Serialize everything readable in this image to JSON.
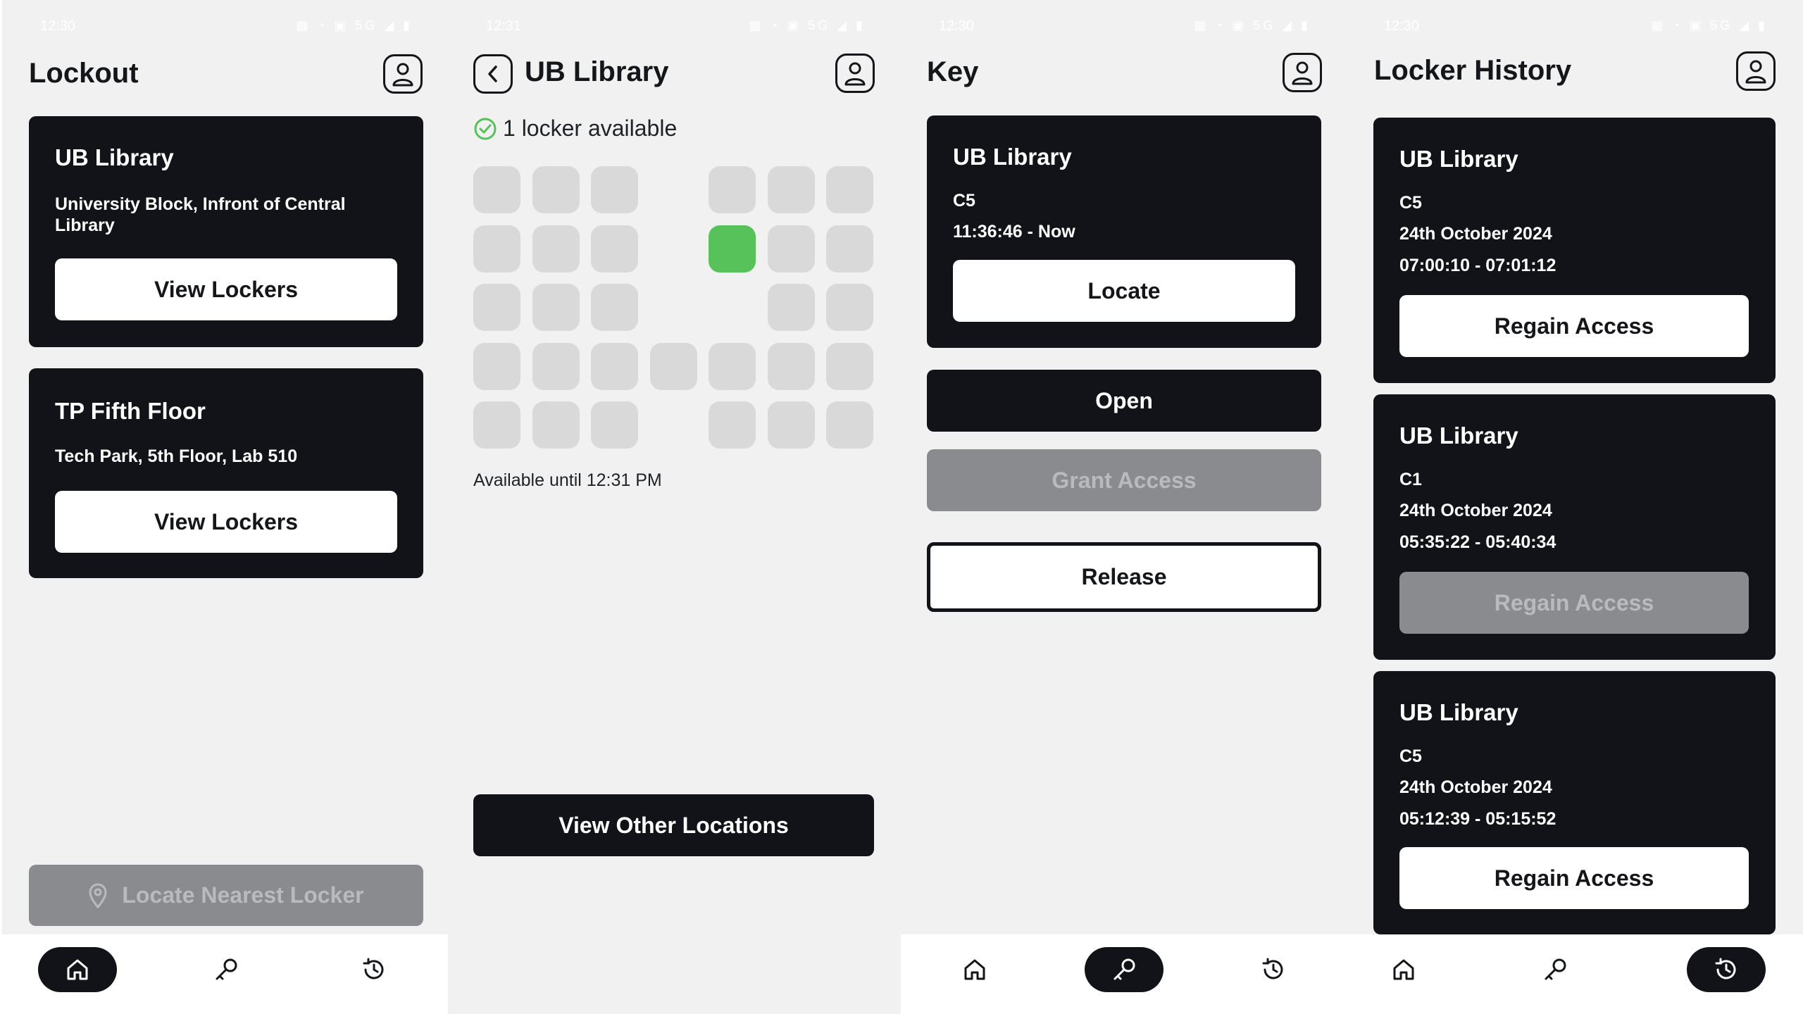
{
  "screens": {
    "home": {
      "status": {
        "time": "12:30",
        "icons": "▦ ◔ ▣ 5G ◢ ▮"
      },
      "title": "Lockout",
      "locations": [
        {
          "name": "UB Library",
          "address": "University Block, Infront of Central Library",
          "button": "View Lockers"
        },
        {
          "name": "TP Fifth Floor",
          "address": "Tech Park, 5th Floor, Lab 510",
          "button": "View Lockers"
        }
      ],
      "locate_nearest": "Locate Nearest Locker"
    },
    "library": {
      "status": {
        "time": "12:31",
        "icons": "▦ ◔ ▣ 5G ◢ ▮"
      },
      "title": "UB Library",
      "available_text": "1 locker available",
      "available_until": "Available until 12:31 PM",
      "locker_rows": [
        [
          1,
          1,
          1,
          0,
          1,
          1,
          1
        ],
        [
          1,
          1,
          1,
          0,
          2,
          1,
          1
        ],
        [
          1,
          1,
          1,
          0,
          0,
          1,
          1
        ],
        [
          1,
          1,
          1,
          1,
          1,
          1,
          1
        ],
        [
          1,
          1,
          1,
          0,
          1,
          1,
          1
        ]
      ],
      "view_other": "View Other Locations"
    },
    "key": {
      "status": {
        "time": "12:30",
        "icons": "▦ ◔ ▣ 5G ◢ ▮"
      },
      "title": "Key",
      "card": {
        "location": "UB Library",
        "locker": "C5",
        "time": "11:36:46 - Now",
        "button": "Locate"
      },
      "open": "Open",
      "grant": "Grant Access",
      "release": "Release"
    },
    "history": {
      "status": {
        "time": "12:30",
        "icons": "▦ ◔ ▣ 5G ◢ ▮"
      },
      "title": "Locker History",
      "entries": [
        {
          "location": "UB Library",
          "locker": "C5",
          "date": "24th October 2024",
          "time": "07:00:10 - 07:01:12",
          "button": "Regain Access",
          "enabled": true
        },
        {
          "location": "UB Library",
          "locker": "C1",
          "date": "24th October 2024",
          "time": "05:35:22 - 05:40:34",
          "button": "Regain Access",
          "enabled": false
        },
        {
          "location": "UB Library",
          "locker": "C5",
          "date": "24th October 2024",
          "time": "05:12:39 - 05:15:52",
          "button": "Regain Access",
          "enabled": true
        }
      ]
    }
  },
  "colors": {
    "dark": "#111318",
    "available": "#57c25a",
    "locker": "#d9d9d9",
    "disabled": "#8a8b8e"
  }
}
